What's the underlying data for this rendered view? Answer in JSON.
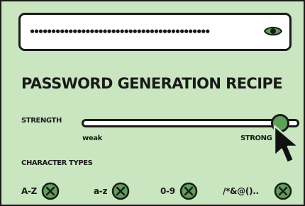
{
  "password": {
    "masked_value": "••••••••••••••••••••••••••••••••••••••••••"
  },
  "recipe": {
    "title": "PASSWORD GENERATION RECIPE",
    "strength": {
      "label": "STRENGTH",
      "min_label": "weak",
      "max_label": "STRONG",
      "level": 0.95
    },
    "character_types": {
      "label": "CHARACTER TYPES",
      "options": [
        {
          "label": "A-Z",
          "icon": "x-circle-icon"
        },
        {
          "label": "a-z",
          "icon": "x-circle-icon"
        },
        {
          "label": "0-9",
          "icon": "x-circle-icon"
        },
        {
          "label": "/*&@()...",
          "icon": "x-circle-icon"
        }
      ]
    }
  },
  "colors": {
    "background": "#c9e6c0",
    "accent": "#5ea05a",
    "ink": "#1a1a1a"
  }
}
